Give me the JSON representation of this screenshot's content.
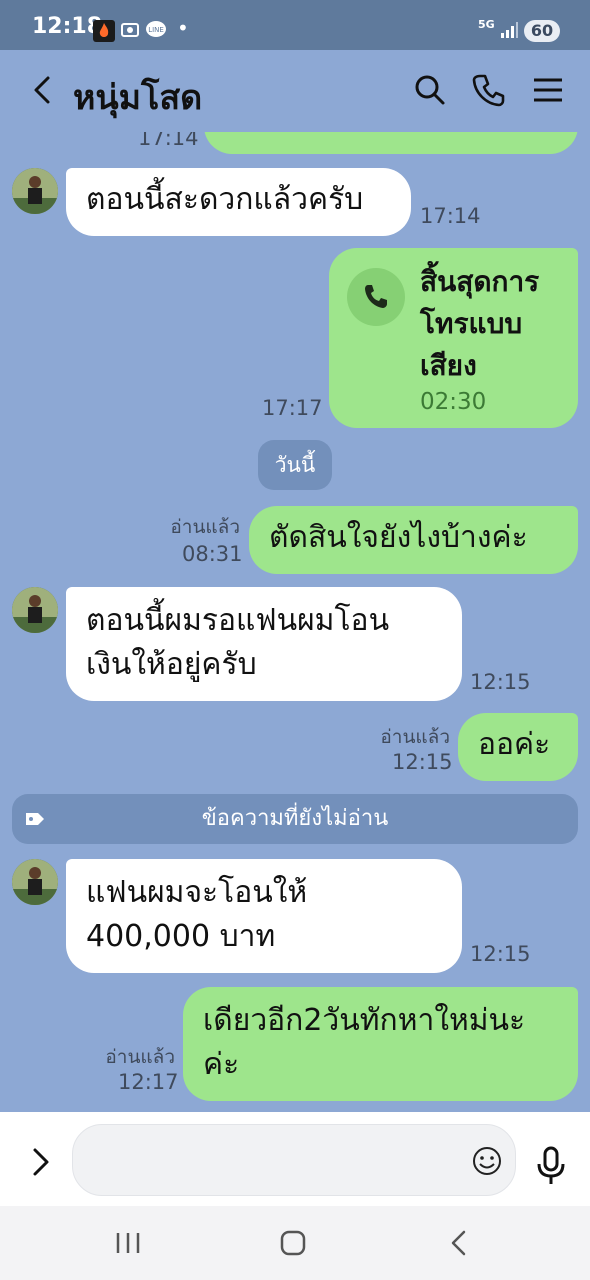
{
  "status_bar": {
    "time": "12:18",
    "network": "5G",
    "battery": "60",
    "dot": "•"
  },
  "header": {
    "title": "หนุ่มโสด"
  },
  "messages": {
    "cut_time": "17:14",
    "m1_text": "ตอนนี้สะดวกแล้วครับ",
    "m1_time": "17:14",
    "call_text_1": "สิ้นสุดการ",
    "call_text_2": "โทรแบบ",
    "call_text_3": "เสียง",
    "call_duration": "02:30",
    "call_time": "17:17",
    "date_divider": "วันนี้",
    "m2_read": "อ่านแล้ว",
    "m2_time": "08:31",
    "m2_text": "ตัดสินใจยังไงบ้างค่ะ",
    "m3_line1": "ตอนนี้ผมรอแฟนผมโอน",
    "m3_line2": "เงินให้อยู่ครับ",
    "m3_time": "12:15",
    "m4_read": "อ่านแล้ว",
    "m4_time": "12:15",
    "m4_text": "ออค่ะ",
    "unread_divider": "ข้อความที่ยังไม่อ่าน",
    "m5_line1": "แฟนผมจะโอนให้",
    "m5_line2": "400,000 บาท",
    "m5_time": "12:15",
    "m6_read": "อ่านแล้ว",
    "m6_time": "12:17",
    "m6_line1": "เดียวอีก2วันทักหาใหม่นะ",
    "m6_line2": "ค่ะ"
  },
  "colors": {
    "background": "#8da8d4",
    "outgoing": "#9ee58c",
    "incoming": "#ffffff",
    "status_bar": "#5f7a9c"
  },
  "icons": [
    "back-chevron-icon",
    "search-icon",
    "phone-icon",
    "menu-icon",
    "expand-icon",
    "emoji-icon",
    "microphone-icon",
    "recent-apps-icon",
    "home-icon",
    "back-nav-icon",
    "tag-icon"
  ]
}
